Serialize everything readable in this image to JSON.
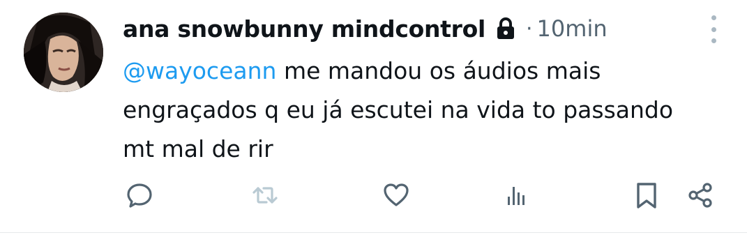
{
  "tweet": {
    "display_name": "ana snowbunny mindcontrol",
    "separator": "·",
    "timestamp": "10min",
    "mention": "@wayoceann",
    "text": "me mandou os áudios mais engraçados q eu já escutei na vida to passando mt mal de rir"
  },
  "icons": {
    "protected": "lock-icon",
    "more": "more-vertical-icon",
    "reply": "reply-icon",
    "retweet": "retweet-icon",
    "like": "heart-icon",
    "views": "views-icon",
    "bookmark": "bookmark-icon",
    "share": "share-icon"
  },
  "colors": {
    "text": "#0f1419",
    "secondary": "#536471",
    "mention": "#1d9bf0",
    "retweet_disabled": "#b9cad3"
  }
}
